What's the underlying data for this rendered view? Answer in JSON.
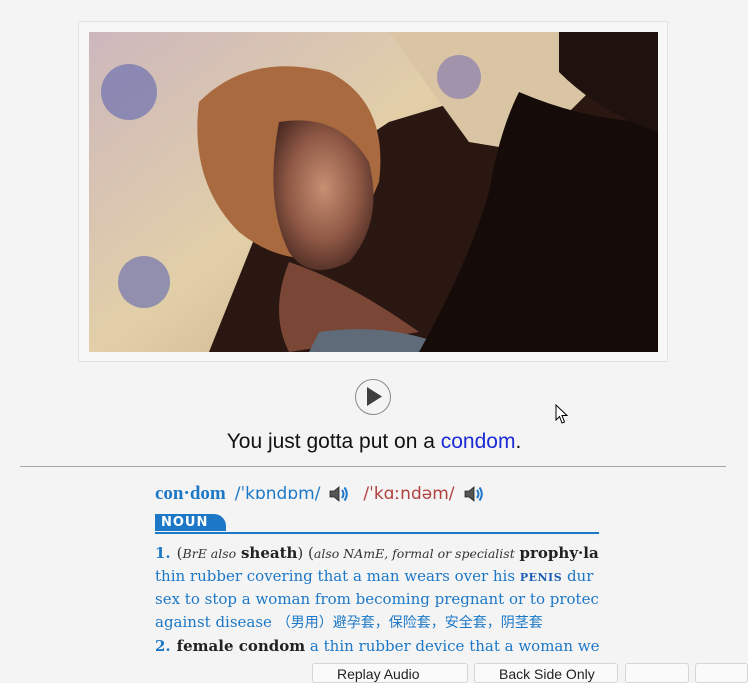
{
  "caption": {
    "before": "You just gotta put on a ",
    "word": "condom",
    "after": "."
  },
  "entry": {
    "headword": "con·dom",
    "phon_bre": "/ˈkɒndɒm/",
    "phon_name": "/ˈkɑːndəm/",
    "pos": "NOUN",
    "sense1": {
      "num": "1.",
      "open": "(",
      "bre_also": "BrE also",
      "sheath": "sheath",
      "close_open": ") (",
      "name_also": "also NAmE, formal or specialist",
      "prophylactic": "prophy·lac·ti",
      "line1": "thin rubber covering that a man wears over his",
      "penis": "penis",
      "line1_end": "dur",
      "line2": "sex to stop a woman from becoming pregnant or to protec",
      "line3": "against disease",
      "chinese": "（男用）避孕套，保险套，安全套，阴茎套"
    },
    "sense2": {
      "num": "2.",
      "term": "female condom",
      "def": "a thin rubber device that a woman wear"
    }
  },
  "buttons": {
    "replay_audio": "Replay Audio",
    "back_side_only": "Back Side Only"
  },
  "icons": {
    "play": "play-icon",
    "speaker": "speaker-icon",
    "cursor": "mouse-cursor-icon"
  },
  "colors": {
    "accent": "#1c78c7",
    "name_phonetic": "#b0413e",
    "caption_word": "#1b2bd6"
  }
}
